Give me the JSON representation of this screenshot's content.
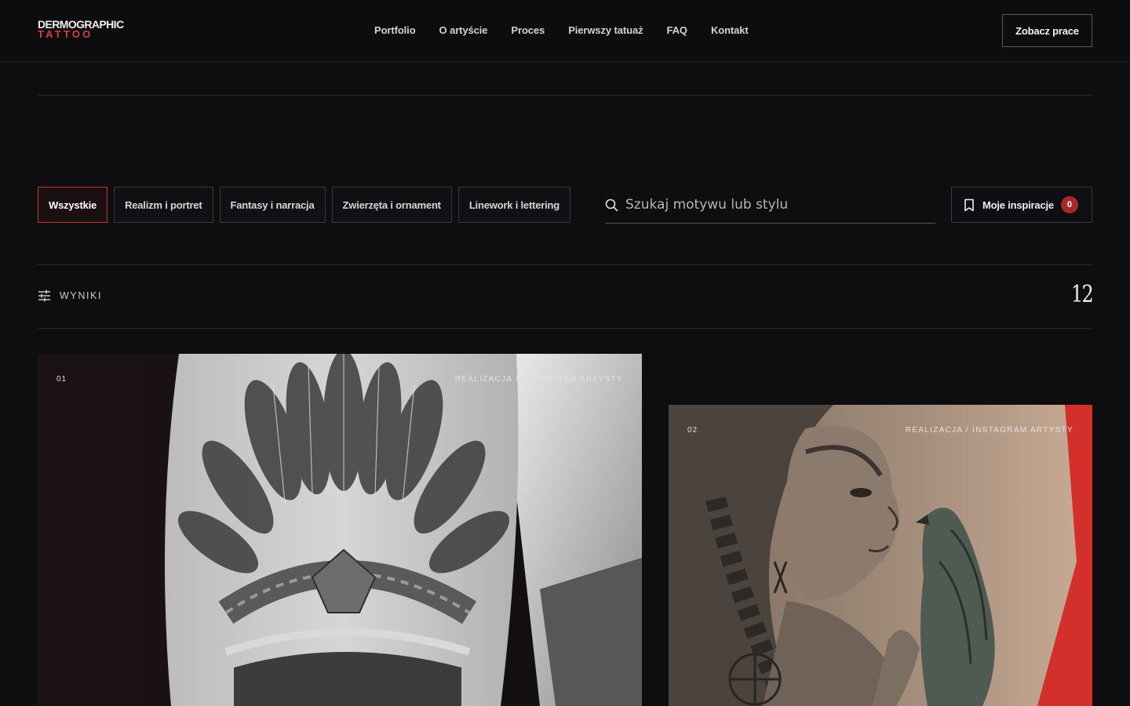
{
  "brand": {
    "line1": "DERMOGRAPHIC",
    "line2": "TATTOO"
  },
  "nav": [
    {
      "label": "Portfolio"
    },
    {
      "label": "O artyście"
    },
    {
      "label": "Proces"
    },
    {
      "label": "Pierwszy tatuaż"
    },
    {
      "label": "FAQ"
    },
    {
      "label": "Kontakt"
    }
  ],
  "header_cta": "Zobacz prace",
  "filters": [
    {
      "label": "Wszystkie",
      "active": true
    },
    {
      "label": "Realizm i portret",
      "active": false
    },
    {
      "label": "Fantasy i narracja",
      "active": false
    },
    {
      "label": "Zwierzęta i ornament",
      "active": false
    },
    {
      "label": "Linework i lettering",
      "active": false
    }
  ],
  "search": {
    "placeholder": "Szukaj motywu lub stylu",
    "value": "",
    "icon": "search-icon"
  },
  "inspirations": {
    "label": "Moje inspiracje",
    "count": "0",
    "icon": "bookmark-icon"
  },
  "results": {
    "label": "WYNIKI",
    "count": "12",
    "icon": "sliders-icon"
  },
  "cards": [
    {
      "number": "01",
      "source": "REALIZACJA / INSTAGRAM ARTYSTY"
    },
    {
      "number": "02",
      "source": "REALIZACJA / INSTAGRAM ARTYSTY"
    }
  ],
  "colors": {
    "accent": "#c3392c",
    "background": "#0e0d10",
    "badge": "#a5282a"
  }
}
